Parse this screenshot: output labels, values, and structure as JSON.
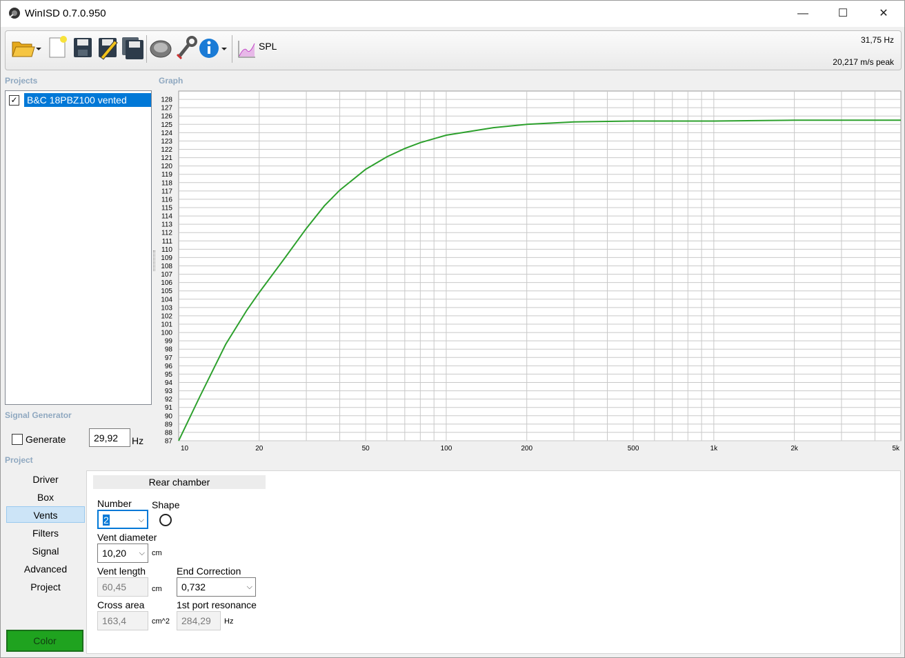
{
  "window": {
    "title": "WinISD 0.7.0.950",
    "minimize": "—",
    "maximize": "☐",
    "close": "✕"
  },
  "toolbar": {
    "buttons": [
      "open-folder-icon",
      "new-project-icon",
      "save-icon",
      "save-as-icon",
      "save-all-icon",
      "driver-icon",
      "tools-wrench-icon",
      "info-icon",
      "spl-graph-icon"
    ],
    "spl_label": "SPL",
    "freq_readout": "31,75 Hz",
    "velocity_readout": "20,217 m/s peak"
  },
  "projects": {
    "section_label": "Projects",
    "items": [
      {
        "name": "B&C 18PBZ100 vented",
        "checked": true
      }
    ]
  },
  "graph": {
    "section_label": "Graph"
  },
  "signal_generator": {
    "section_label": "Signal Generator",
    "generate_label": "Generate",
    "frequency_value": "29,92",
    "unit": "Hz"
  },
  "project_nav": {
    "section_label": "Project",
    "items": [
      "Driver",
      "Box",
      "Vents",
      "Filters",
      "Signal",
      "Advanced",
      "Project"
    ],
    "active": "Vents",
    "color_button": "Color"
  },
  "vents_panel": {
    "header": "Rear chamber",
    "number_label": "Number",
    "number_value": "2",
    "shape_label": "Shape",
    "vent_diameter_label": "Vent diameter",
    "vent_diameter_value": "10,20",
    "vent_diameter_unit": "cm",
    "vent_length_label": "Vent length",
    "vent_length_value": "60,45",
    "vent_length_unit": "cm",
    "end_correction_label": "End Correction",
    "end_correction_value": "0,732",
    "cross_area_label": "Cross area",
    "cross_area_value": "163,4",
    "cross_area_unit": "cm^2",
    "port_resonance_label": "1st port resonance",
    "port_resonance_value": "284,29",
    "port_resonance_unit": "Hz"
  },
  "chart_data": {
    "type": "line",
    "title": "",
    "xlabel": "",
    "ylabel": "",
    "x_scale": "log",
    "xlim": [
      10,
      5000
    ],
    "ylim": [
      87,
      129
    ],
    "y_ticks": [
      87,
      88,
      89,
      90,
      91,
      92,
      93,
      94,
      95,
      96,
      97,
      98,
      99,
      100,
      101,
      102,
      103,
      104,
      105,
      106,
      107,
      108,
      109,
      110,
      111,
      112,
      113,
      114,
      115,
      116,
      117,
      118,
      119,
      120,
      121,
      122,
      123,
      124,
      125,
      126,
      127,
      128
    ],
    "x_tick_labels": [
      {
        "value": 10,
        "label": "10"
      },
      {
        "value": 20,
        "label": "20"
      },
      {
        "value": 50,
        "label": "50"
      },
      {
        "value": 100,
        "label": "100"
      },
      {
        "value": 200,
        "label": "200"
      },
      {
        "value": 500,
        "label": "500"
      },
      {
        "value": 1000,
        "label": "1k"
      },
      {
        "value": 2000,
        "label": "2k"
      },
      {
        "value": 5000,
        "label": "5k"
      }
    ],
    "grid": true,
    "series": [
      {
        "color": "#2ca02c",
        "x": [
          10,
          12,
          15,
          18,
          20,
          25,
          30,
          35,
          40,
          50,
          60,
          70,
          80,
          100,
          150,
          200,
          300,
          500,
          1000,
          2000,
          5000
        ],
        "y": [
          87,
          92.3,
          98.6,
          102.7,
          104.8,
          109.0,
          112.5,
          115.2,
          117.1,
          119.6,
          121.1,
          122.1,
          122.8,
          123.7,
          124.6,
          125.0,
          125.3,
          125.4,
          125.4,
          125.5,
          125.5
        ]
      }
    ]
  }
}
